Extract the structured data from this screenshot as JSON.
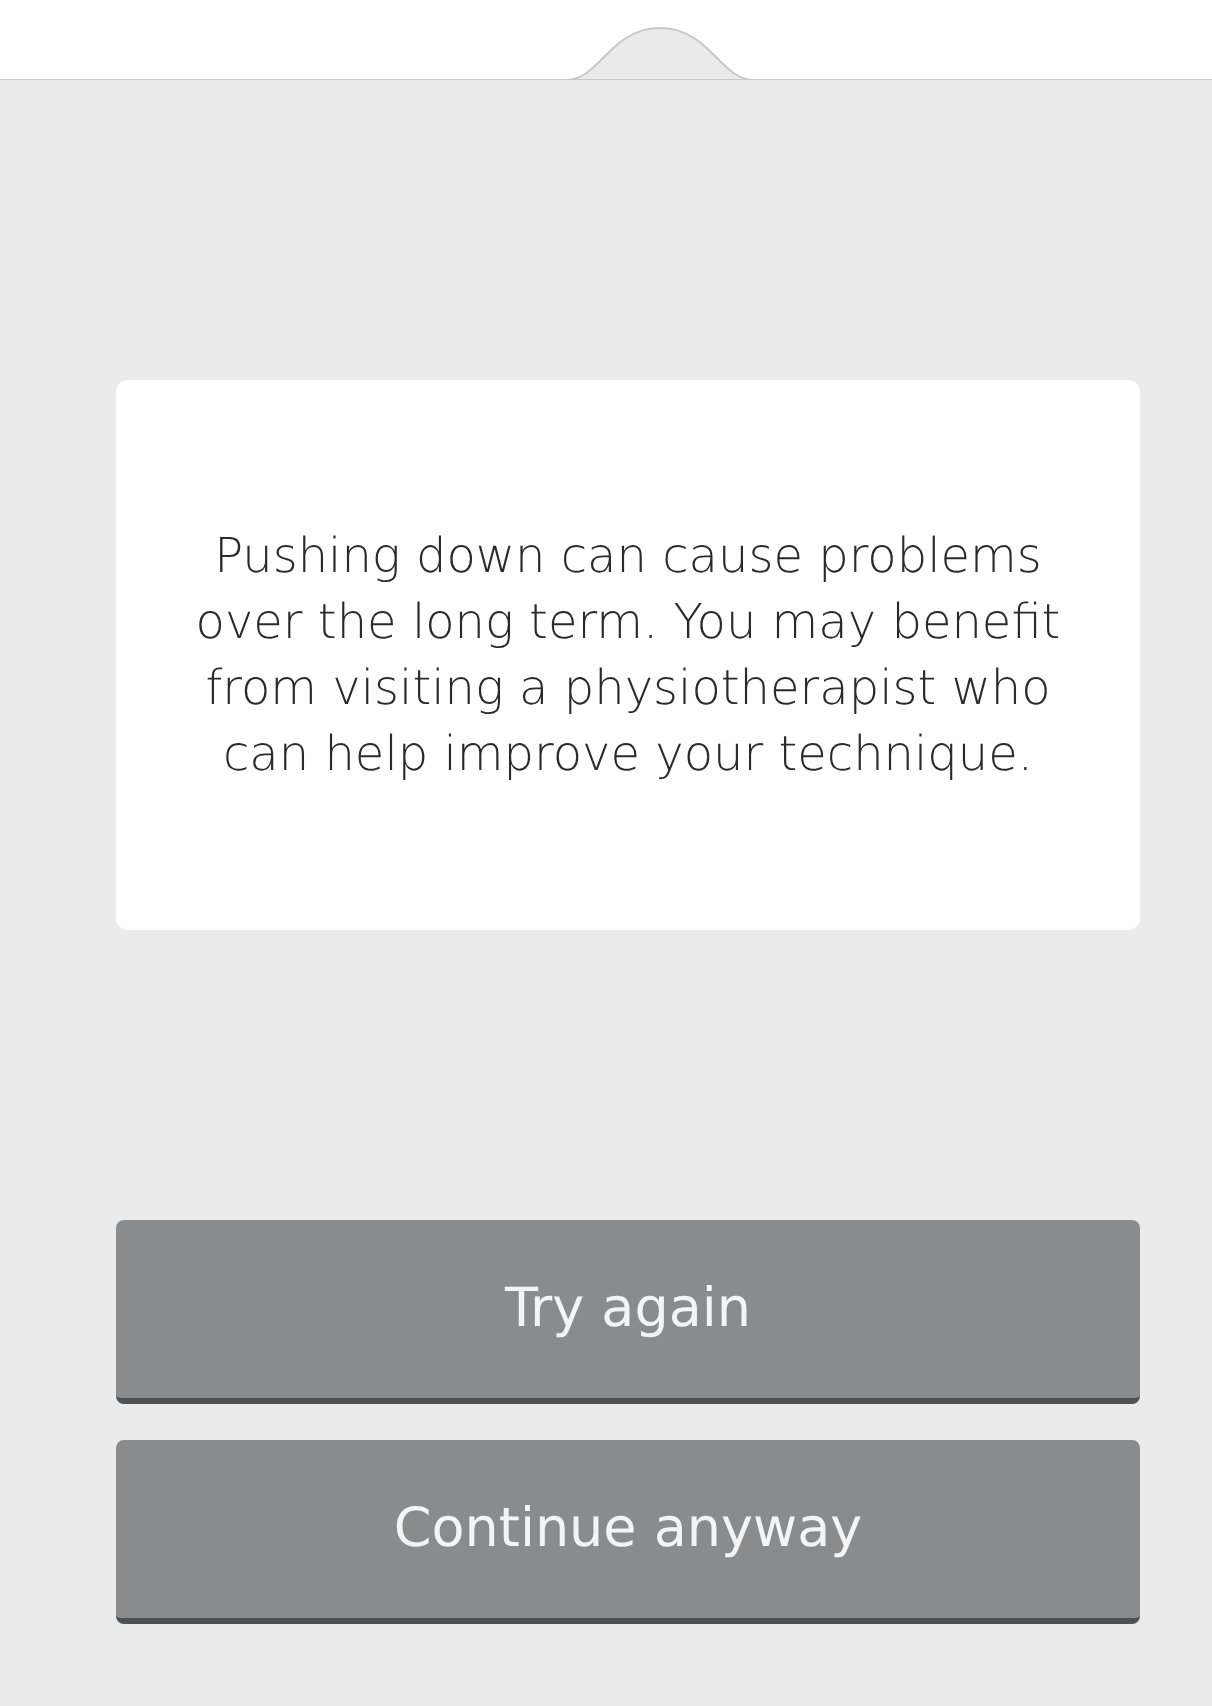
{
  "message": {
    "text": "Pushing down can cause problems over the long term. You may benefit from visiting a physiotherapist who can help improve your technique."
  },
  "buttons": [
    {
      "label": "Try again"
    },
    {
      "label": "Continue anyway"
    }
  ]
}
